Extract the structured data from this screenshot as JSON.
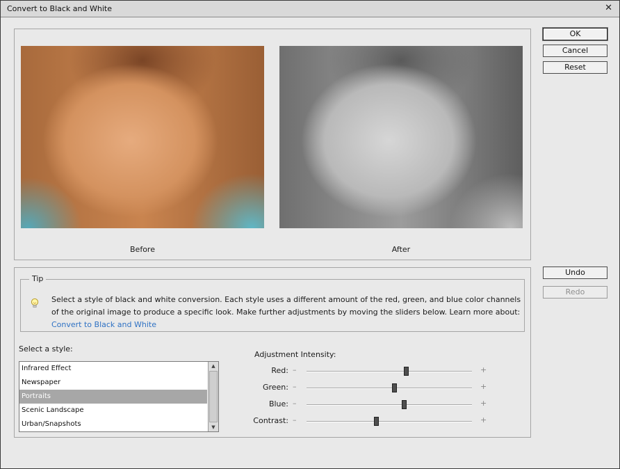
{
  "window": {
    "title": "Convert to Black and White"
  },
  "preview": {
    "before_label": "Before",
    "after_label": "After"
  },
  "buttons": {
    "ok": "OK",
    "cancel": "Cancel",
    "reset": "Reset",
    "undo": "Undo",
    "redo": "Redo"
  },
  "tip": {
    "legend": "Tip",
    "text": "Select a style of black and white conversion. Each style uses a different amount of the red, green, and blue color channels of the original image to produce a specific look. Make further adjustments by moving the sliders below. Learn more about:",
    "link": "Convert to Black and White"
  },
  "styles": {
    "label": "Select a style:",
    "items": [
      "Infrared Effect",
      "Newspaper",
      "Portraits",
      "Scenic Landscape",
      "Urban/Snapshots"
    ],
    "selected": "Portraits"
  },
  "adjustment": {
    "label": "Adjustment Intensity:",
    "sliders": [
      {
        "name": "Red:",
        "value": 0.6
      },
      {
        "name": "Green:",
        "value": 0.53
      },
      {
        "name": "Blue:",
        "value": 0.59
      },
      {
        "name": "Contrast:",
        "value": 0.42
      }
    ],
    "minus": "–",
    "plus": "+"
  }
}
